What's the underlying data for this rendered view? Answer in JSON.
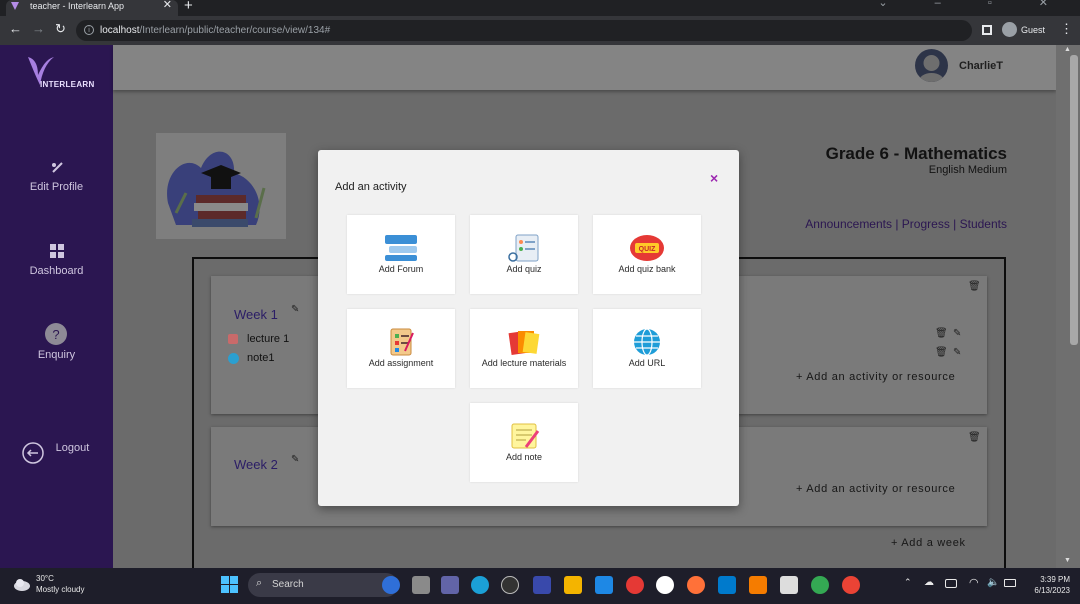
{
  "browser": {
    "tab_title": "teacher - Interlearn App",
    "url_host": "localhost",
    "url_path": "/Interlearn/public/teacher/course/view/134#",
    "profile_label": "Guest"
  },
  "sidebar": {
    "logo_text": "INTERLEARN",
    "items": [
      {
        "label": "Edit Profile",
        "icon": "edit-profile-icon"
      },
      {
        "label": "Dashboard",
        "icon": "dashboard-icon"
      },
      {
        "label": "Enquiry",
        "icon": "question-icon"
      },
      {
        "label": "Logout",
        "icon": "logout-icon"
      }
    ]
  },
  "header": {
    "user_name": "CharlieT"
  },
  "course": {
    "title": "Grade 6 - Mathematics",
    "medium": "English Medium",
    "links": [
      "Announcements",
      "Progress",
      "Students"
    ]
  },
  "weeks": [
    {
      "title": "Week 1",
      "items": [
        {
          "label": "lecture 1",
          "icon": "pdf-icon"
        },
        {
          "label": "note1",
          "icon": "globe-icon"
        }
      ],
      "add_activity": "+ Add an activity or resource"
    },
    {
      "title": "Week 2",
      "items": [],
      "add_activity": "+ Add an activity or resource"
    }
  ],
  "add_week": "+ Add a week",
  "modal": {
    "title": "Add an activity",
    "close": "×",
    "tiles": [
      {
        "label": "Add Forum",
        "icon": "forum-icon"
      },
      {
        "label": "Add quiz",
        "icon": "quiz-icon"
      },
      {
        "label": "Add quiz bank",
        "icon": "quiz-bank-icon"
      },
      {
        "label": "Add assignment",
        "icon": "assignment-icon"
      },
      {
        "label": "Add lecture materials",
        "icon": "lecture-materials-icon"
      },
      {
        "label": "Add URL",
        "icon": "url-globe-icon"
      },
      {
        "label": "Add note",
        "icon": "note-icon"
      }
    ],
    "quiz_badge": "QUIZ"
  },
  "taskbar": {
    "temperature": "30°C",
    "weather": "Mostly cloudy",
    "search_label": "Search",
    "time": "3:39 PM",
    "date": "6/13/2023"
  },
  "colors": {
    "sidebar": "#2b1651",
    "accent": "#9c27b0",
    "link": "#2b1651"
  }
}
